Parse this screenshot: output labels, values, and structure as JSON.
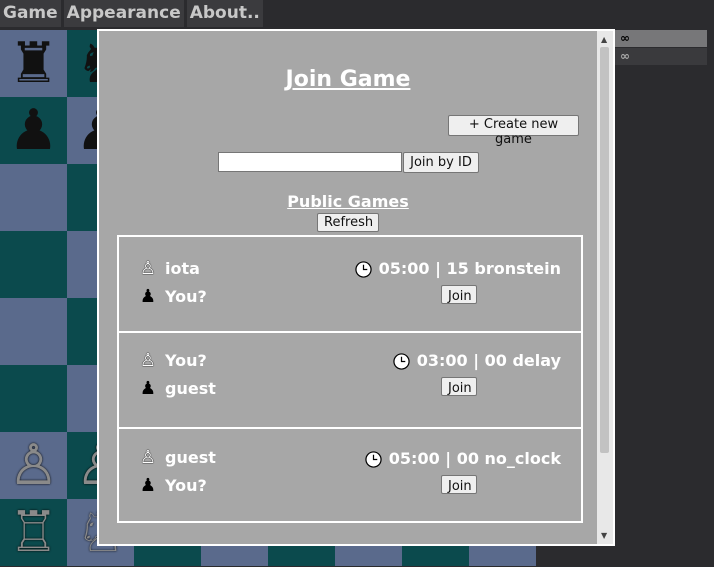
{
  "menu": [
    "Game",
    "Appearance",
    "About.."
  ],
  "side_panel": {
    "rows": [
      "∞",
      "∞"
    ]
  },
  "modal": {
    "title": "Join Game",
    "create_button": "+ Create new game",
    "join_id_input": "",
    "join_id_button": "Join by ID",
    "public_title": "Public Games",
    "refresh_button": "Refresh",
    "games": [
      {
        "white": "iota",
        "black": "You?",
        "time": "05:00 | 15 bronstein",
        "join": "Join"
      },
      {
        "white": "You?",
        "black": "guest",
        "time": "03:00 | 00 delay",
        "join": "Join"
      },
      {
        "white": "guest",
        "black": "You?",
        "time": "05:00 | 00 no_clock",
        "join": "Join"
      }
    ]
  },
  "colors": {
    "light_square": "#5a6a8c",
    "dark_square": "#0b4a4d",
    "modal_bg": "#a7a7a7"
  },
  "icons": {
    "white_pawn": "♙",
    "black_pawn": "♟",
    "clock": "clock-icon"
  }
}
